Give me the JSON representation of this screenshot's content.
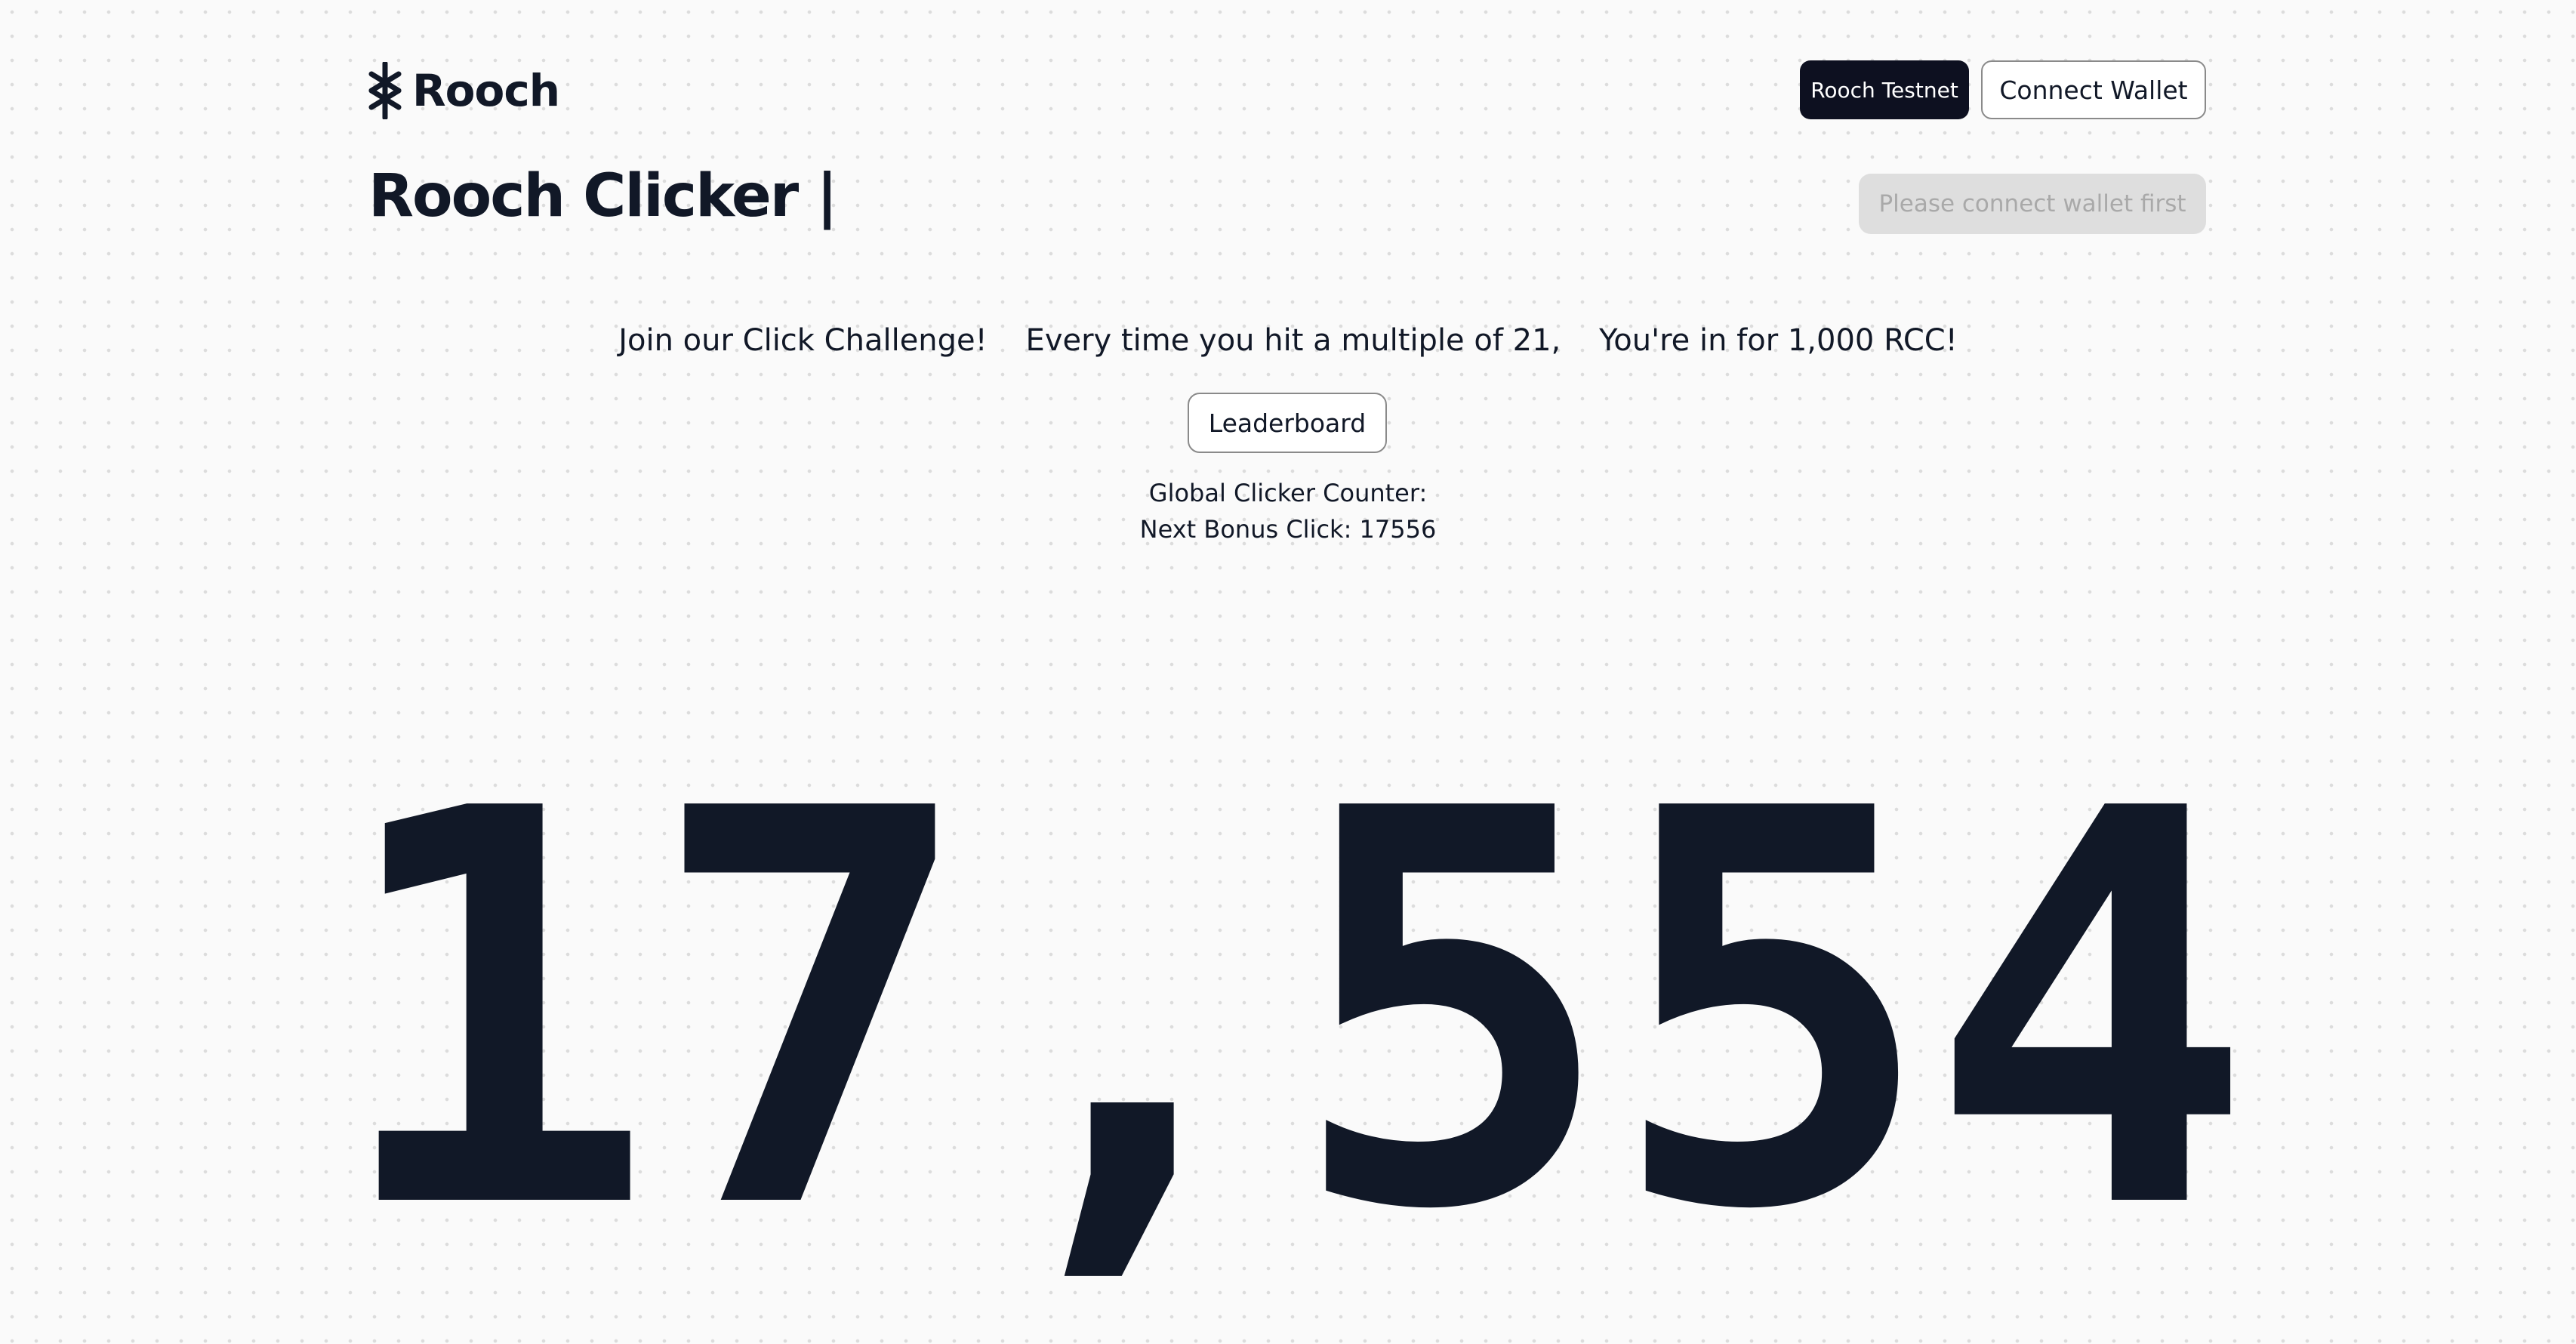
{
  "brand": {
    "name": "Rooch",
    "logo_icon": "rooch-logo-icon"
  },
  "header": {
    "network_label": "Rooch Testnet",
    "connect_label": "Connect Wallet"
  },
  "page": {
    "title": "Rooch Clicker |",
    "connect_first_label": "Please connect wallet first"
  },
  "challenge": {
    "text": "Join our Click Challenge!    Every time you hit a multiple of 21,    You're in for 1,000 RCC!"
  },
  "leaderboard": {
    "label": "Leaderboard"
  },
  "stats": {
    "global_counter_label": "Global Clicker Counter:",
    "next_bonus_label": "Next Bonus Click: 17556"
  },
  "counter": {
    "value": "17,554"
  },
  "colors": {
    "text": "#111827",
    "dark_button": "#0d1020",
    "disabled_bg": "#dedede",
    "disabled_text": "#a9a9a9",
    "background": "#fafafa"
  }
}
